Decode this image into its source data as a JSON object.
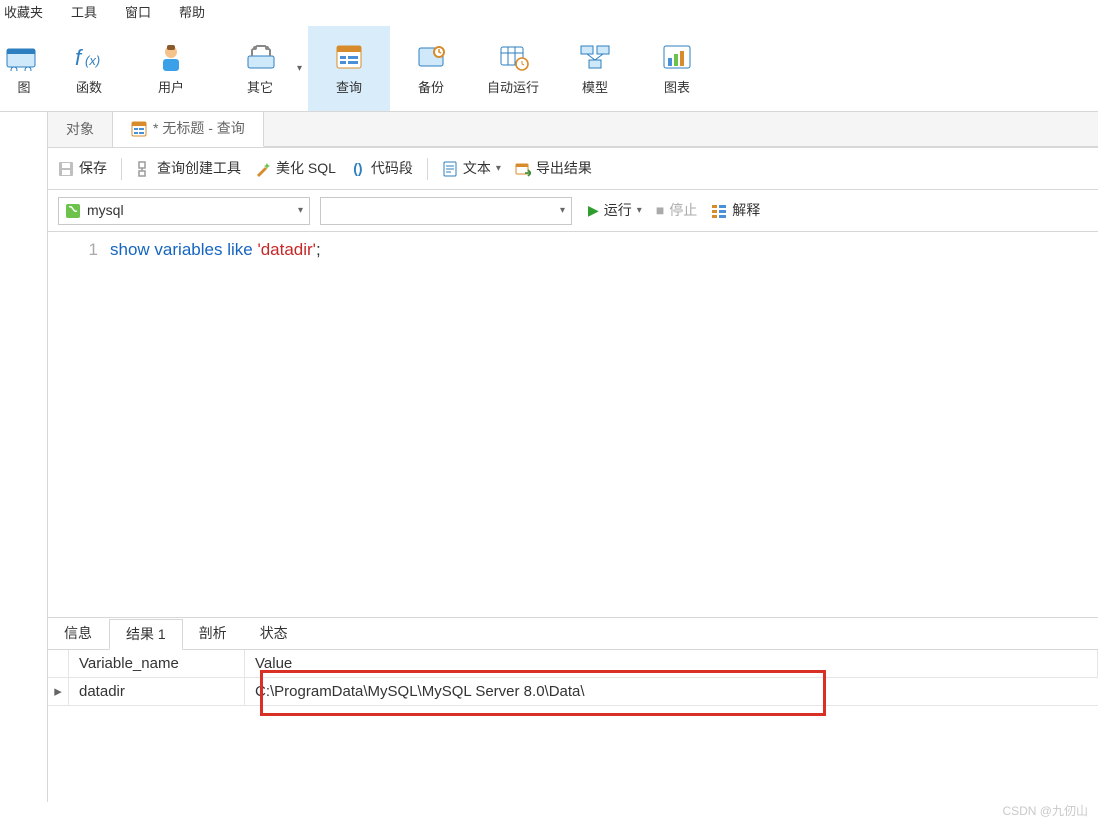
{
  "menus": {
    "favorites": "收藏夹",
    "tools": "工具",
    "window": "窗口",
    "help": "帮助"
  },
  "ribbon": {
    "view": "图",
    "function": "函数",
    "user": "用户",
    "other": "其它",
    "query": "查询",
    "backup": "备份",
    "schedule": "自动运行",
    "model": "模型",
    "chart": "图表"
  },
  "tabs": {
    "objects": "对象",
    "query_untitled": "* 无标题 - 查询"
  },
  "toolbar": {
    "save": "保存",
    "query_builder": "查询创建工具",
    "beautify_sql": "美化 SQL",
    "snippets": "代码段",
    "text": "文本",
    "export": "导出结果"
  },
  "conn": {
    "connection": "mysql",
    "schema": "",
    "run": "运行",
    "stop": "停止",
    "explain": "解释"
  },
  "editor": {
    "line_no": "1",
    "kw_show": "show",
    "kw_variables": "variables",
    "kw_like": "like",
    "str_value": "'datadir'",
    "semicolon": ";"
  },
  "result_tabs": {
    "info": "信息",
    "result1": "结果 1",
    "profile": "剖析",
    "status": "状态"
  },
  "grid": {
    "headers": {
      "name": "Variable_name",
      "value": "Value"
    },
    "rows": [
      {
        "name": "datadir",
        "value": "C:\\ProgramData\\MySQL\\MySQL Server 8.0\\Data\\"
      }
    ]
  },
  "watermark": "CSDN @九仞山"
}
